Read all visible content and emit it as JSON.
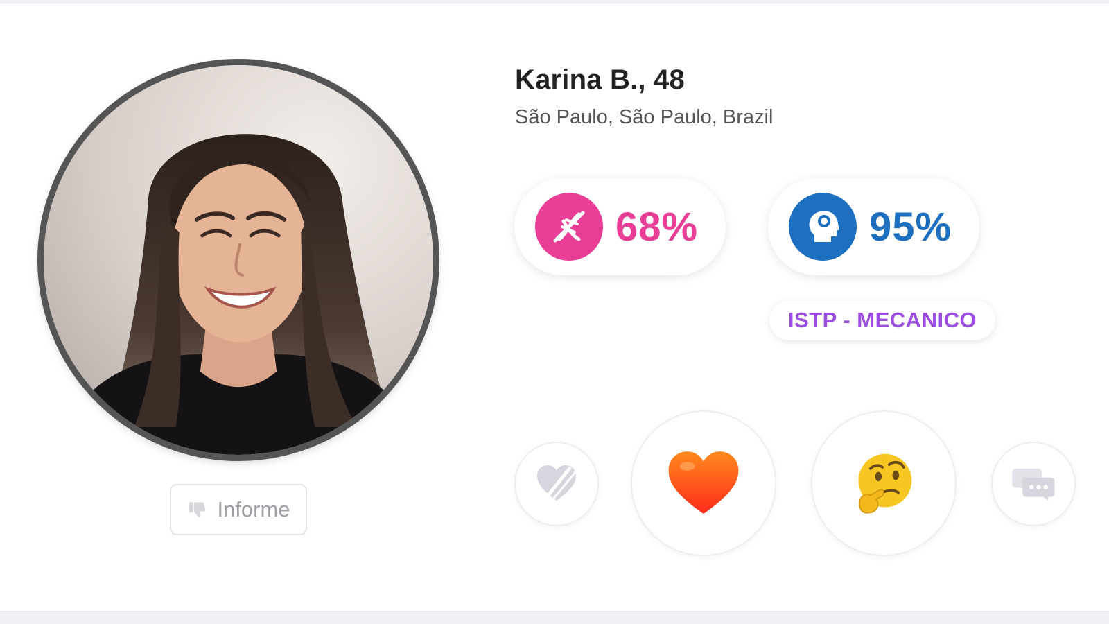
{
  "profile": {
    "name_age": "Karina B., 48",
    "location": "São Paulo, São Paulo, Brazil",
    "photo_alt": "Karina B. profile photo"
  },
  "report": {
    "label": "Informe",
    "icon": "thumbs-down-icon"
  },
  "scores": {
    "chemistry": {
      "value": "68%",
      "icon": "dna-icon",
      "color": "#e83e96"
    },
    "personality": {
      "value": "95%",
      "icon": "head-mind-icon",
      "color": "#1d6fbf"
    }
  },
  "personality_type": {
    "label": "ISTP - MECANICO",
    "color": "#9b4de0"
  },
  "actions": {
    "pass": {
      "icon": "broken-heart-icon",
      "color": "#d6d6de"
    },
    "like": {
      "icon": "heart-icon",
      "color": "#ff4a1c"
    },
    "maybe": {
      "icon": "thinking-face-icon",
      "color": "#f7c623"
    },
    "chat": {
      "icon": "chat-bubbles-icon",
      "color": "#d6d6de"
    }
  }
}
